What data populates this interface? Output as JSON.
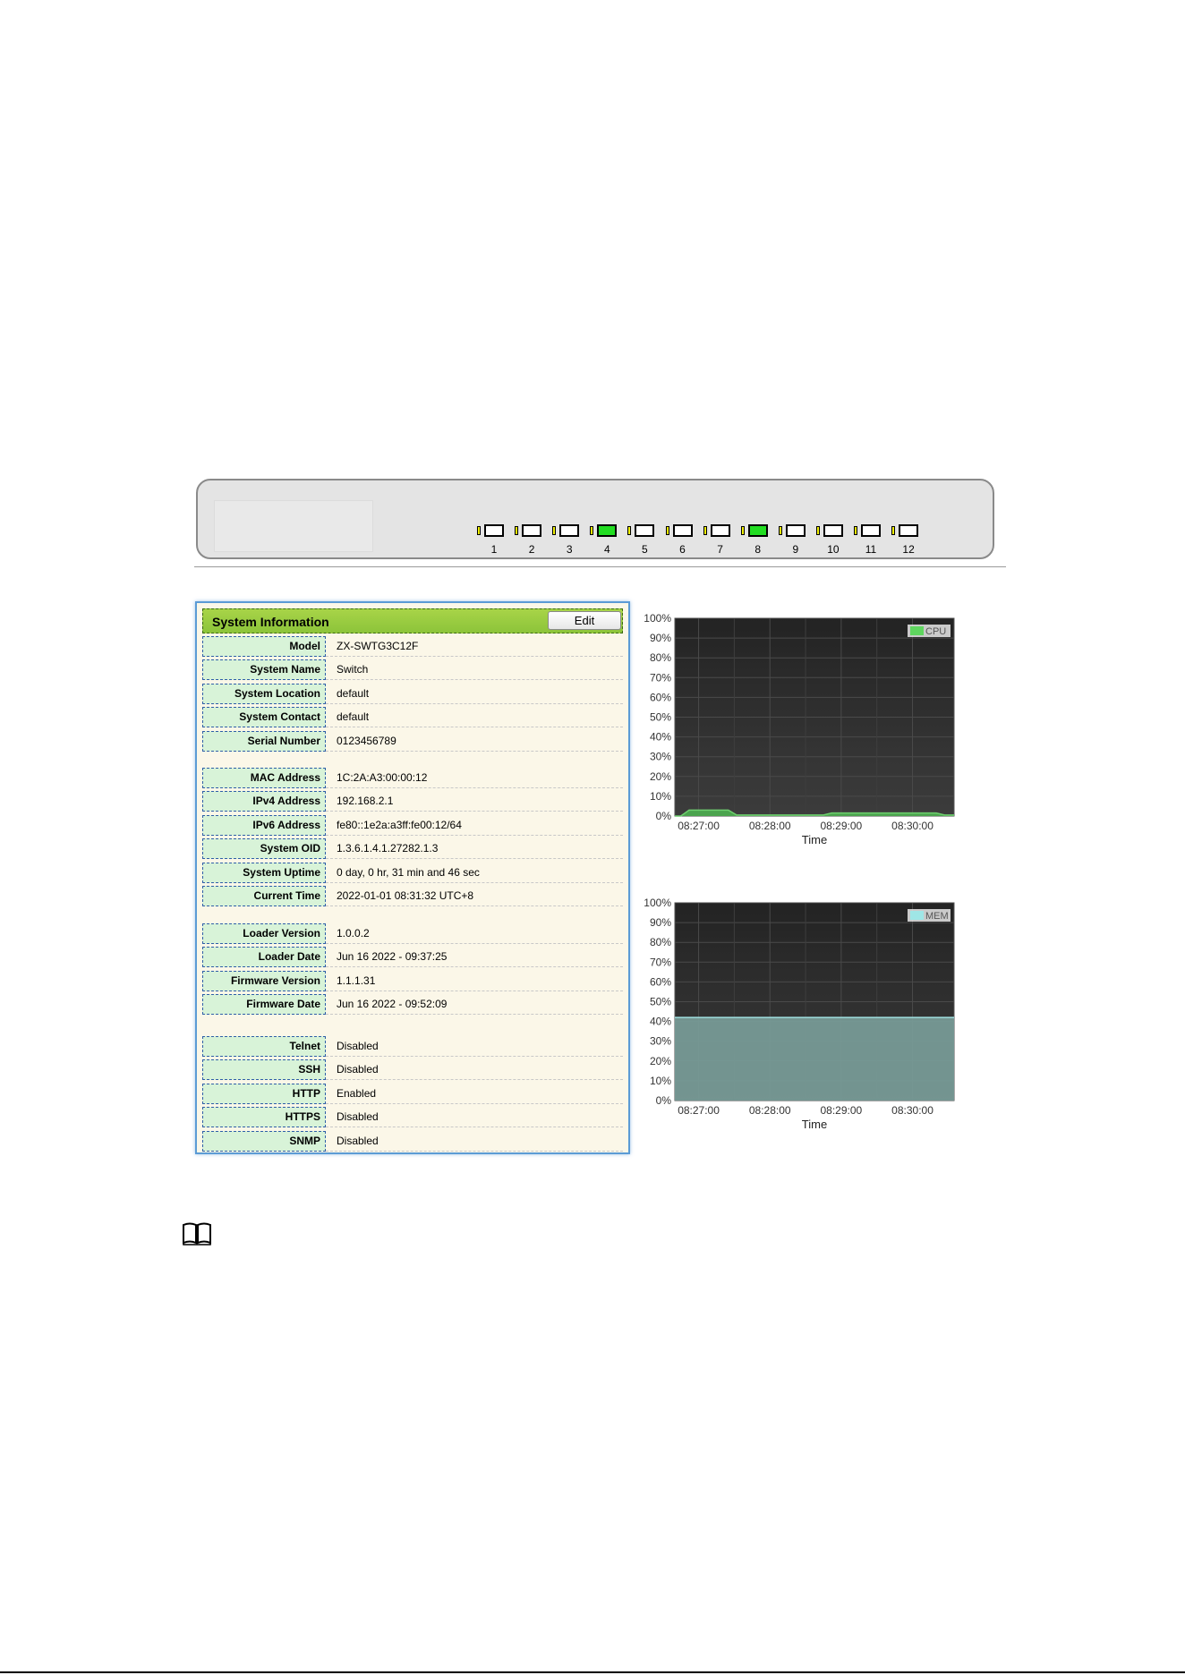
{
  "ports": [
    {
      "label": "1",
      "link": false
    },
    {
      "label": "2",
      "link": false
    },
    {
      "label": "3",
      "link": false
    },
    {
      "label": "4",
      "link": true
    },
    {
      "label": "5",
      "link": false
    },
    {
      "label": "6",
      "link": false
    },
    {
      "label": "7",
      "link": false
    },
    {
      "label": "8",
      "link": true
    },
    {
      "label": "9",
      "link": false
    },
    {
      "label": "10",
      "link": false
    },
    {
      "label": "11",
      "link": false
    },
    {
      "label": "12",
      "link": false
    }
  ],
  "system_info": {
    "title": "System Information",
    "edit_label": "Edit",
    "groups": [
      [
        {
          "label": "Model",
          "value": "ZX-SWTG3C12F"
        },
        {
          "label": "System Name",
          "value": "Switch"
        },
        {
          "label": "System Location",
          "value": "default"
        },
        {
          "label": "System Contact",
          "value": "default"
        },
        {
          "label": "Serial Number",
          "value": "0123456789"
        }
      ],
      [
        {
          "label": "MAC Address",
          "value": "1C:2A:A3:00:00:12"
        },
        {
          "label": "IPv4 Address",
          "value": "192.168.2.1"
        },
        {
          "label": "IPv6 Address",
          "value": "fe80::1e2a:a3ff:fe00:12/64"
        },
        {
          "label": "System OID",
          "value": "1.3.6.1.4.1.27282.1.3"
        },
        {
          "label": "System Uptime",
          "value": "0 day, 0 hr, 31 min and 46 sec"
        },
        {
          "label": "Current Time",
          "value": "2022-01-01 08:31:32 UTC+8"
        }
      ],
      [
        {
          "label": "Loader Version",
          "value": "1.0.0.2"
        },
        {
          "label": "Loader Date",
          "value": "Jun 16 2022 - 09:37:25"
        },
        {
          "label": "Firmware Version",
          "value": "1.1.1.31"
        },
        {
          "label": "Firmware Date",
          "value": "Jun 16 2022 - 09:52:09"
        }
      ],
      [
        {
          "label": "Telnet",
          "value": "Disabled"
        },
        {
          "label": "SSH",
          "value": "Disabled"
        },
        {
          "label": "HTTP",
          "value": "Enabled"
        },
        {
          "label": "HTTPS",
          "value": "Disabled"
        },
        {
          "label": "SNMP",
          "value": "Disabled"
        }
      ]
    ]
  },
  "colors": {
    "chart_bg": "#2b2b2b",
    "cpu_fill": "#4caf50",
    "mem_fill": "#7a9e9a",
    "mem_line": "#9fe0e0",
    "header_green": "#8cc43a",
    "card_border": "#5b9bd5"
  },
  "chart_data": [
    {
      "type": "area",
      "legend": "CPU",
      "xlabel": "Time",
      "x_ticks": [
        "08:27:00",
        "08:28:00",
        "08:29:00",
        "08:30:00"
      ],
      "y_ticks": [
        "0%",
        "10%",
        "20%",
        "30%",
        "40%",
        "50%",
        "60%",
        "70%",
        "80%",
        "90%",
        "100%"
      ],
      "ylim": [
        0,
        100
      ],
      "x": [
        "08:26:40",
        "08:26:45",
        "08:26:52",
        "08:27:25",
        "08:27:32",
        "08:27:40",
        "08:28:45",
        "08:28:52",
        "08:30:20",
        "08:30:27",
        "08:30:35"
      ],
      "values": [
        0,
        0,
        3,
        3,
        0.5,
        0.5,
        0.5,
        1.5,
        1.5,
        0.5,
        0.5
      ],
      "grid": true,
      "legend_position": "top-right"
    },
    {
      "type": "area",
      "legend": "MEM",
      "xlabel": "Time",
      "x_ticks": [
        "08:27:00",
        "08:28:00",
        "08:29:00",
        "08:30:00"
      ],
      "y_ticks": [
        "0%",
        "10%",
        "20%",
        "30%",
        "40%",
        "50%",
        "60%",
        "70%",
        "80%",
        "90%",
        "100%"
      ],
      "ylim": [
        0,
        100
      ],
      "x": [
        "08:26:40",
        "08:30:35"
      ],
      "values": [
        42,
        42
      ],
      "grid": true,
      "legend_position": "top-right"
    }
  ]
}
